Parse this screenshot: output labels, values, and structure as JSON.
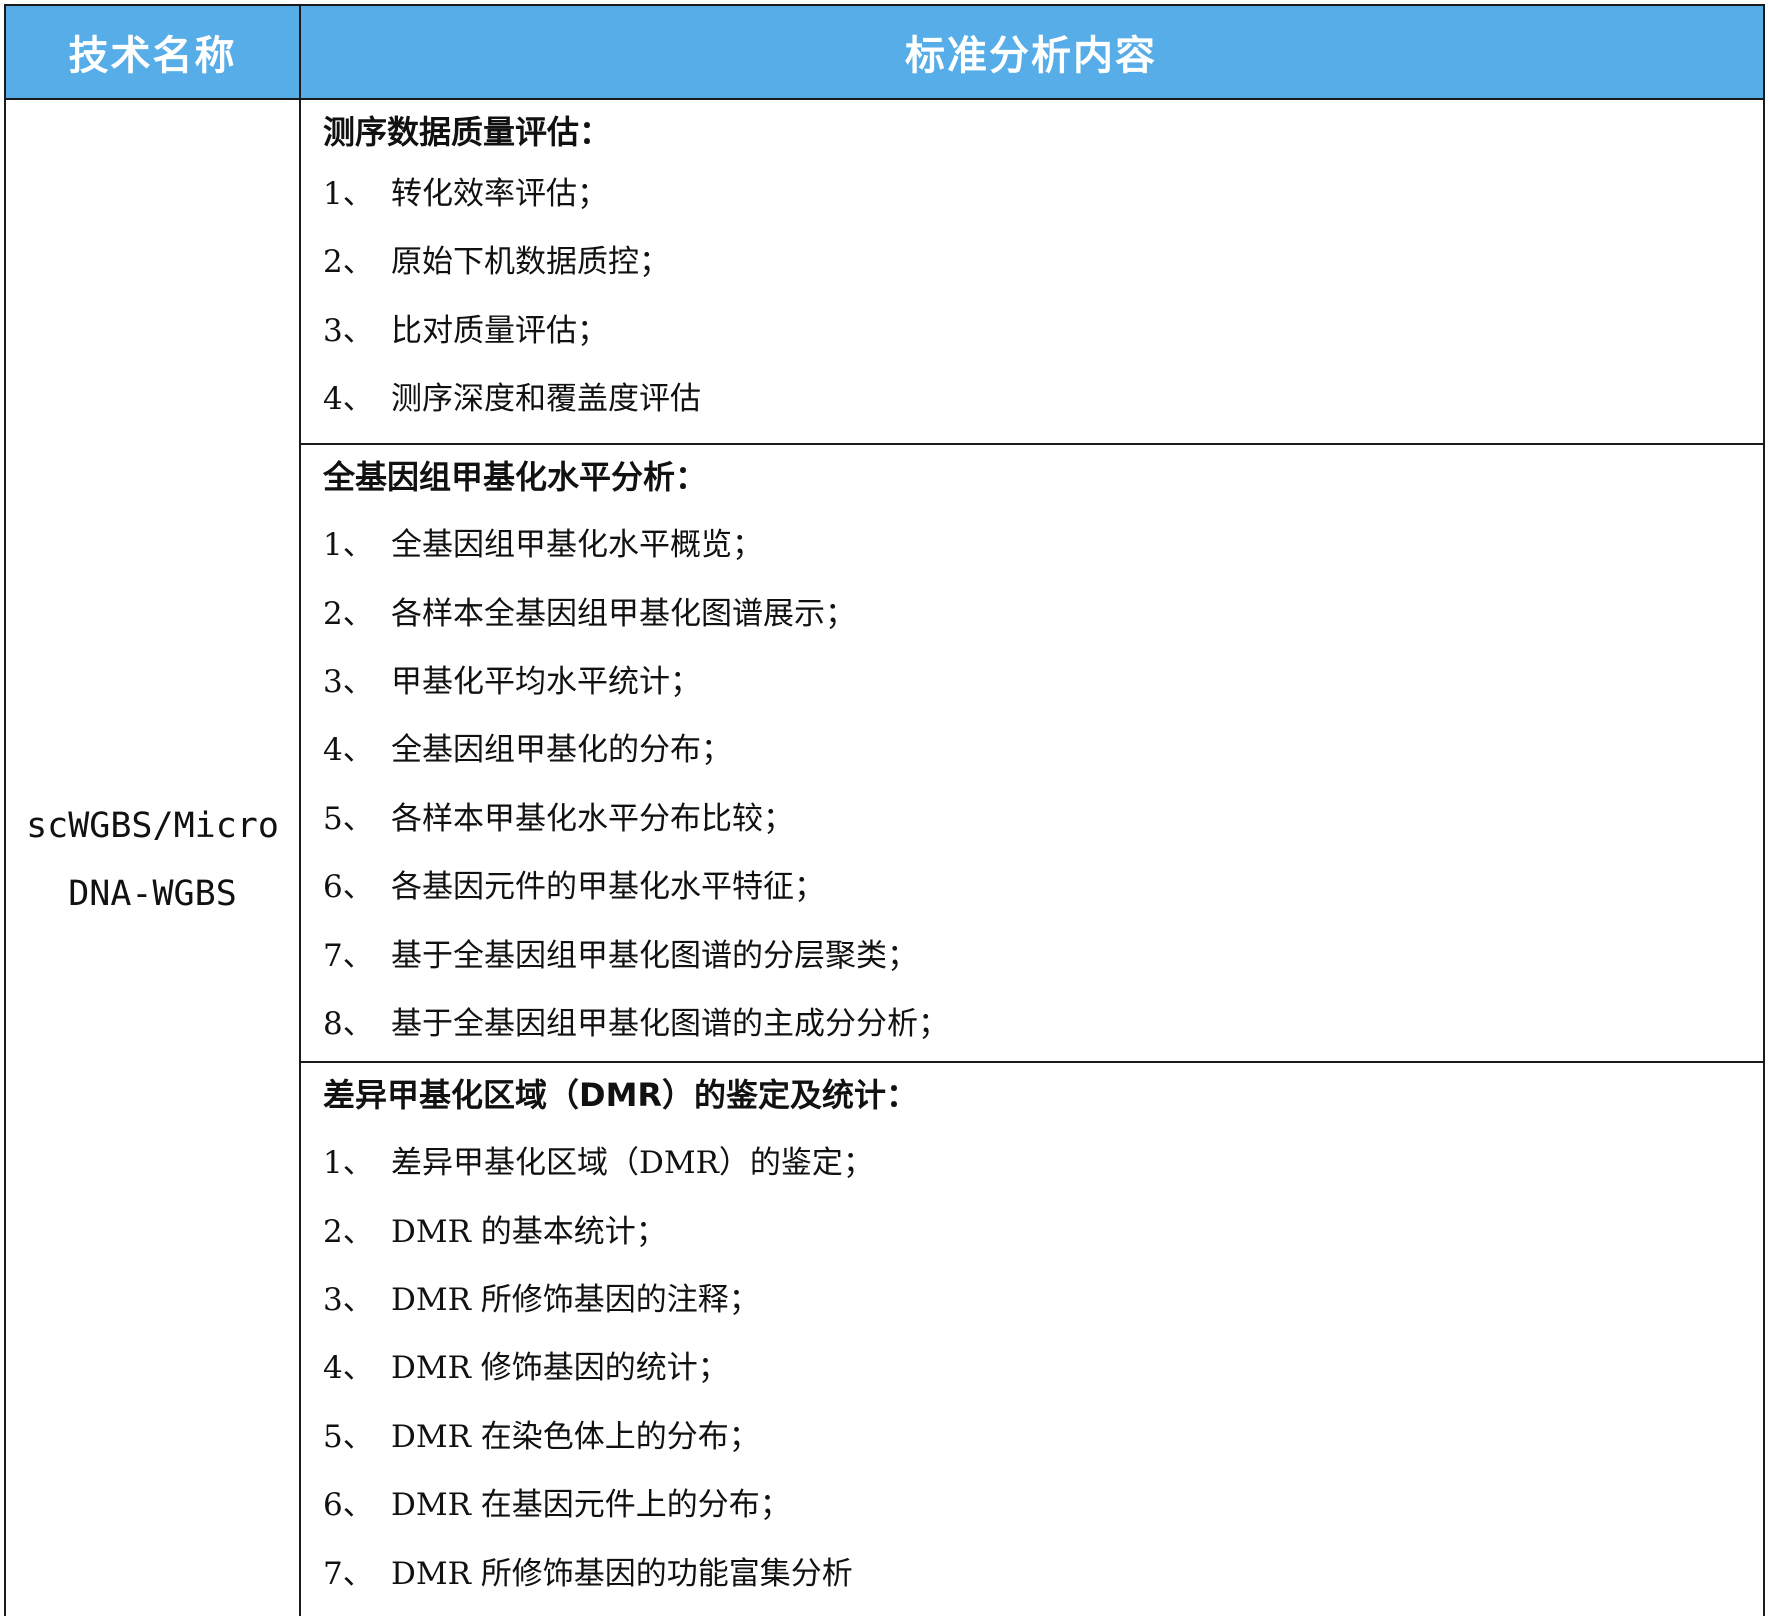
{
  "header": {
    "col_tech": "技术名称",
    "col_content": "标准分析内容"
  },
  "tech_name": {
    "line1": "scWGBS/Micro",
    "line2": "DNA-WGBS"
  },
  "sections": [
    {
      "title": "测序数据质量评估：",
      "items": [
        {
          "num": "1、",
          "text": "转化效率评估；"
        },
        {
          "num": "2、",
          "text": "原始下机数据质控；"
        },
        {
          "num": "3、",
          "text": "比对质量评估；"
        },
        {
          "num": "4、",
          "text": "测序深度和覆盖度评估"
        }
      ]
    },
    {
      "title": "全基因组甲基化水平分析：",
      "items": [
        {
          "num": "1、",
          "text": "全基因组甲基化水平概览；"
        },
        {
          "num": "2、",
          "text": "各样本全基因组甲基化图谱展示；"
        },
        {
          "num": "3、",
          "text": "甲基化平均水平统计；"
        },
        {
          "num": "4、",
          "text": "全基因组甲基化的分布；"
        },
        {
          "num": "5、",
          "text": "各样本甲基化水平分布比较；"
        },
        {
          "num": "6、",
          "text": "各基因元件的甲基化水平特征；"
        },
        {
          "num": "7、",
          "text": "基于全基因组甲基化图谱的分层聚类；"
        },
        {
          "num": "8、",
          "text": "基于全基因组甲基化图谱的主成分分析；"
        }
      ]
    },
    {
      "title": "差异甲基化区域（DMR）的鉴定及统计：",
      "items": [
        {
          "num": "1、",
          "text": "差异甲基化区域（DMR）的鉴定；"
        },
        {
          "num": "2、",
          "text": "DMR 的基本统计；"
        },
        {
          "num": "3、",
          "text": "DMR 所修饰基因的注释；"
        },
        {
          "num": "4、",
          "text": "DMR 修饰基因的统计；"
        },
        {
          "num": "5、",
          "text": "DMR 在染色体上的分布；"
        },
        {
          "num": "6、",
          "text": "DMR 在基因元件上的分布；"
        },
        {
          "num": "7、",
          "text": "DMR 所修饰基因的功能富集分析"
        }
      ]
    }
  ]
}
